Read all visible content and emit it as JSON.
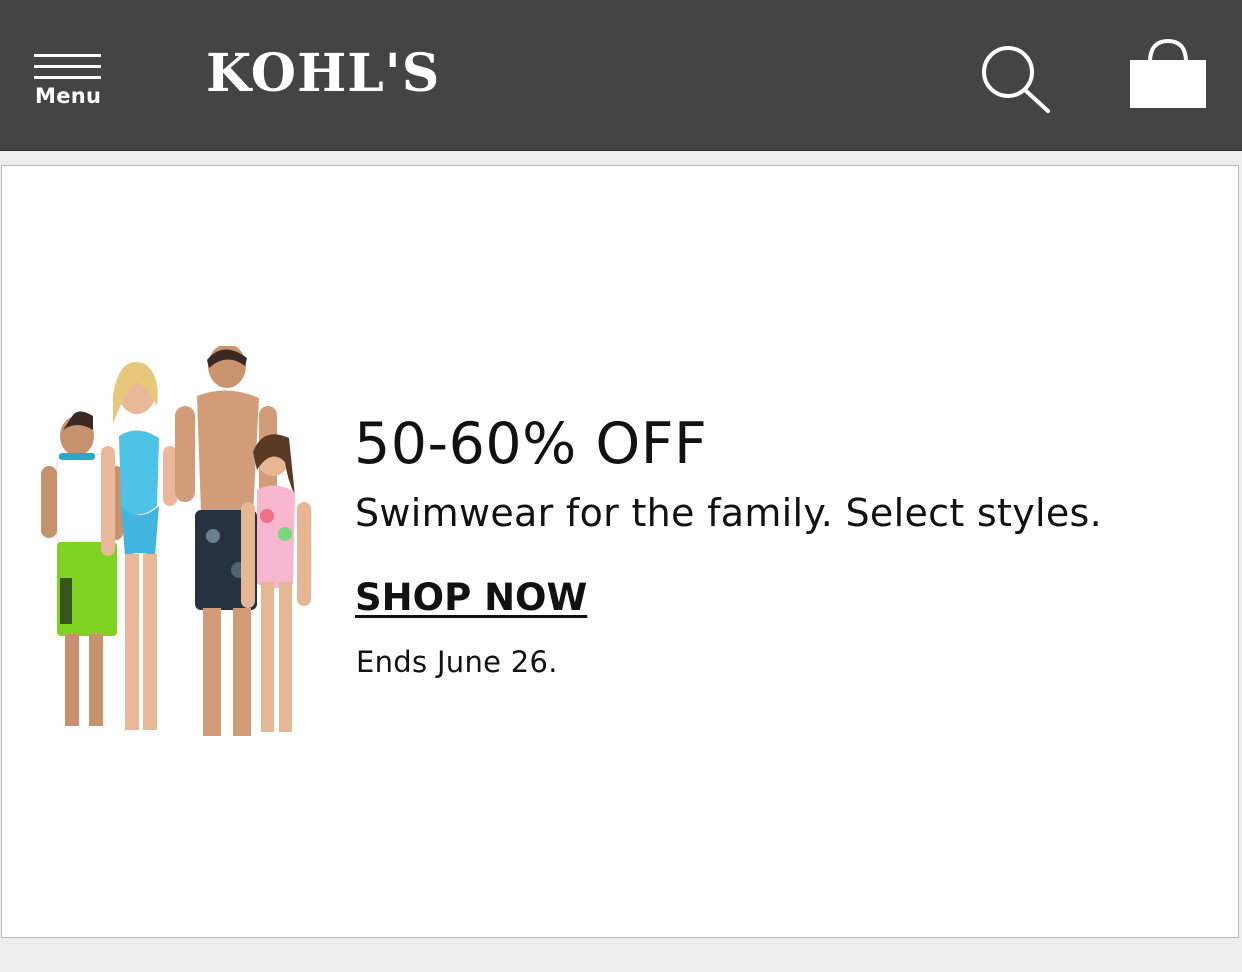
{
  "header": {
    "menu_label": "Menu",
    "logo_text": "KOHL'S",
    "background_color": "#444444",
    "icons": {
      "menu": "hamburger-menu-icon",
      "search": "search-icon",
      "cart": "shopping-bag-icon"
    }
  },
  "promo": {
    "headline": "50-60% OFF",
    "subhead": "Swimwear for the family. Select styles.",
    "cta_label": "SHOP NOW",
    "end_date": "Ends June 26."
  }
}
